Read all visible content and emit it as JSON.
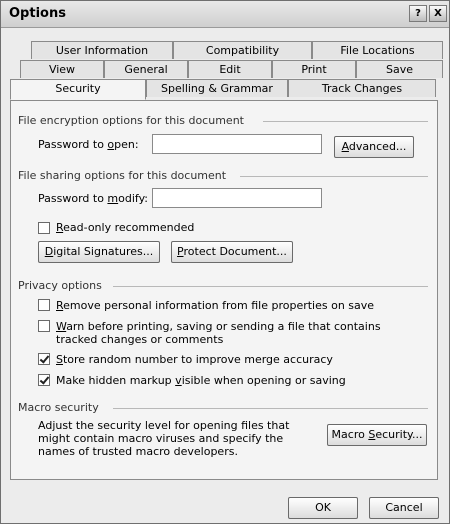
{
  "window": {
    "title": "Options"
  },
  "titlebar_buttons": {
    "help": "?",
    "close": "X"
  },
  "tabs_row1": [
    "User Information",
    "Compatibility",
    "File Locations"
  ],
  "tabs_row2": [
    "View",
    "General",
    "Edit",
    "Print",
    "Save"
  ],
  "tabs_row3": [
    "Security",
    "Spelling & Grammar",
    "Track Changes"
  ],
  "active_tab": "Security",
  "encryption": {
    "header": "File encryption options for this document",
    "password_label": "Password to open:",
    "password_value": "",
    "advanced_button": "Advanced..."
  },
  "sharing": {
    "header": "File sharing options for this document",
    "modify_label": "Password to modify:",
    "modify_value": "",
    "readonly_label": "Read-only recommended",
    "readonly_checked": false,
    "digital_signatures_button": "Digital Signatures...",
    "protect_document_button": "Protect Document..."
  },
  "privacy": {
    "header": "Privacy options",
    "options": [
      {
        "label": "Remove personal information from file properties on save",
        "checked": false
      },
      {
        "label": "Warn before printing, saving or sending a file that contains tracked changes or comments",
        "checked": false
      },
      {
        "label": "Store random number to improve merge accuracy",
        "checked": true
      },
      {
        "label": "Make hidden markup visible when opening or saving",
        "checked": true
      }
    ]
  },
  "macro": {
    "header": "Macro security",
    "description": "Adjust the security level for opening files that might contain macro viruses and specify the names of trusted macro developers.",
    "button": "Macro Security..."
  },
  "footer": {
    "ok": "OK",
    "cancel": "Cancel"
  }
}
